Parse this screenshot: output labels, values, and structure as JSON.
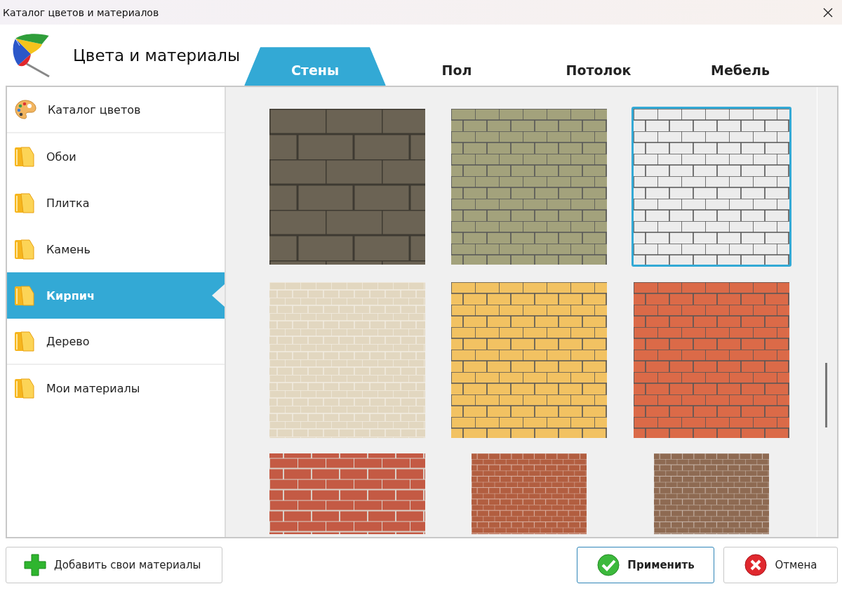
{
  "window": {
    "title": "Каталог цветов и материалов"
  },
  "header": {
    "title": "Цвета и материалы"
  },
  "tabs": [
    {
      "label": "Стены",
      "selected": true
    },
    {
      "label": "Пол",
      "selected": false
    },
    {
      "label": "Потолок",
      "selected": false
    },
    {
      "label": "Мебель",
      "selected": false
    }
  ],
  "sidebar": {
    "items": [
      {
        "label": "Каталог цветов",
        "kind": "palette",
        "selected": false
      },
      {
        "label": "Обои",
        "kind": "folder",
        "selected": false
      },
      {
        "label": "Плитка",
        "kind": "folder",
        "selected": false
      },
      {
        "label": "Камень",
        "kind": "folder",
        "selected": false
      },
      {
        "label": "Кирпич",
        "kind": "folder",
        "selected": true
      },
      {
        "label": "Дерево",
        "kind": "folder",
        "selected": false
      },
      {
        "label": "Мои материалы",
        "kind": "folder",
        "selected": false
      }
    ]
  },
  "materials": [
    {
      "kind": "block",
      "color": "#6b6354",
      "selected": false
    },
    {
      "kind": "brick",
      "color": "#a3a27c",
      "selected": false
    },
    {
      "kind": "brick",
      "color": "#ececec",
      "selected": true
    },
    {
      "kind": "fine-brick",
      "color": "#e2d7c0",
      "selected": false
    },
    {
      "kind": "brick",
      "color": "#f2c262",
      "selected": false
    },
    {
      "kind": "brick",
      "color": "#db6a48",
      "selected": false
    },
    {
      "kind": "wide-brick",
      "color": "#c45a44",
      "selected": false
    },
    {
      "kind": "fine-brick",
      "color": "#b25e40",
      "selected": false
    },
    {
      "kind": "fine-brick",
      "color": "#8e6a52",
      "selected": false
    }
  ],
  "buttons": {
    "add": "Добавить свои материалы",
    "apply": "Применить",
    "cancel": "Отмена"
  }
}
